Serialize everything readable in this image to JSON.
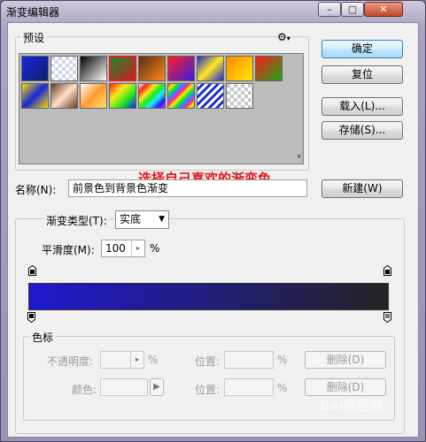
{
  "window": {
    "title": "渐变编辑器",
    "min_label": "–",
    "max_label": "▢",
    "close_label": "✕"
  },
  "presets": {
    "label": "预设",
    "gear_glyph": "⚙",
    "menu_glyph": "▾",
    "note": "选择自己喜欢的渐变色",
    "row1": [
      "linear-gradient(135deg,#1428d8,#102070)",
      "repeating-conic-gradient(#ffffff 0 25%,#cfd4e8 0 50%) 0 0/8px 8px",
      "linear-gradient(135deg,#000000,#ffffff)",
      "linear-gradient(135deg,#1e8a2a,#c81e1e)",
      "linear-gradient(135deg,#5a2a10,#ff8a1e)",
      "linear-gradient(135deg,#ff1e1e,#3a1ee0)",
      "linear-gradient(135deg,#1a2ad8,#ffe81e,#1a2ad8)",
      "linear-gradient(135deg,#ff8a00,#ffe800)",
      "linear-gradient(135deg,#ff1818,#18a818)"
    ],
    "row2": [
      "linear-gradient(135deg,#ffd800,#1428d8,#ffd800)",
      "linear-gradient(135deg,#6a3a1e,#ffe0c8,#6a3a1e)",
      "linear-gradient(135deg,#ffffff,#ff9a30,#ffe070)",
      "linear-gradient(135deg,#ff1e1e,#ffe81e,#1ee81e,#1e1eff)",
      "linear-gradient(135deg,#ffffff,#ff1e1e,#ffe81e,#1ee81e,#1ee8ff,#1e1eff,#ff1eff)",
      "repeating-linear-gradient(135deg,#ff1e1e 0,#ffe81e 4px,#1ee81e 8px,#1e8aff 12px,#ff1eff 16px)",
      "repeating-linear-gradient(135deg,#ffffff 0 3px,#1428d8 3px 6px)",
      "repeating-conic-gradient(#ffffff 0 25%,#c8c8c8 0 50%) 0 0/8px 8px"
    ]
  },
  "buttons": {
    "ok": "确定",
    "reset": "复位",
    "load": "载入(L)...",
    "save": "存储(S)...",
    "new": "新建(W)",
    "delete1": "删除(D)",
    "delete2": "删除(D)"
  },
  "name": {
    "label": "名称(N):",
    "value": "前景色到背景色渐变"
  },
  "gradient": {
    "type_label": "渐变类型(T):",
    "type_value": "实底",
    "smooth_label": "平滑度(M):",
    "smooth_value": "100",
    "smooth_unit": "%",
    "bar_start": "#2018d0",
    "bar_end": "#242424"
  },
  "stops": {
    "label": "色标",
    "opacity_label": "不透明度:",
    "opacity_unit": "%",
    "pos1_label": "位置:",
    "pos1_unit": "%",
    "color_label": "颜色:",
    "pos2_label": "位置:",
    "pos2_unit": "%"
  },
  "watermark": "Bai度经验"
}
